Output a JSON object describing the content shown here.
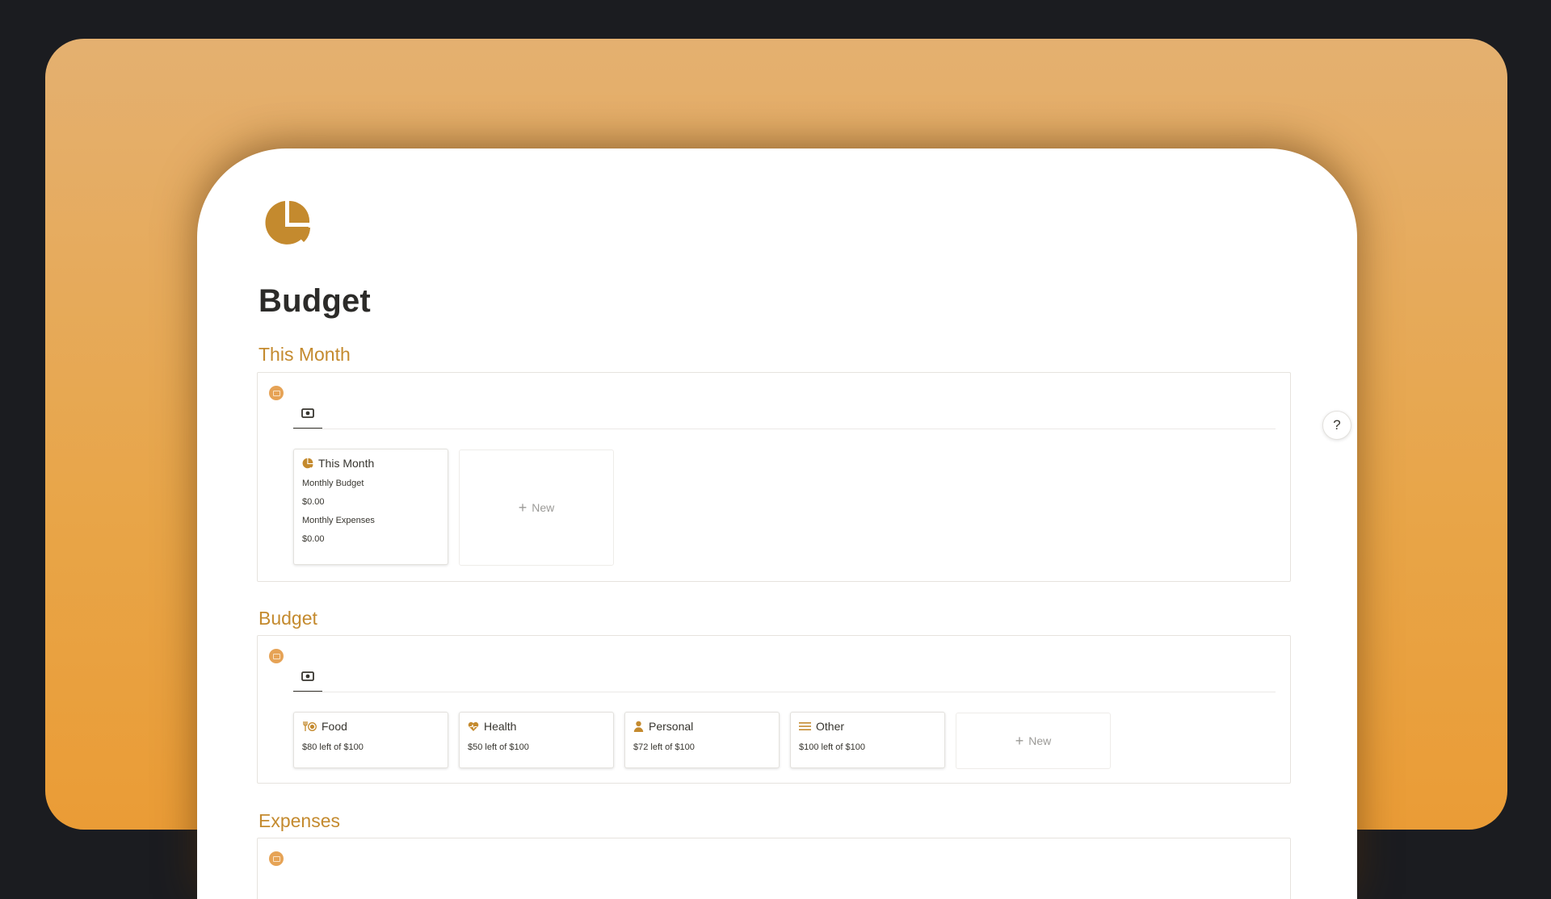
{
  "page": {
    "title": "Budget",
    "icon": "pie-chart-icon",
    "accent_color": "#c48a2e",
    "backdrop_color": "#e8a548"
  },
  "sections": {
    "this_month": {
      "heading": "This Month",
      "view_icon": "money-icon",
      "card": {
        "title": "This Month",
        "icon": "pie-chart-icon",
        "budget_label": "Monthly Budget",
        "budget_value": "$0.00",
        "expenses_label": "Monthly Expenses",
        "expenses_value": "$0.00"
      },
      "new_label": "New"
    },
    "budget": {
      "heading": "Budget",
      "view_icon": "money-icon",
      "cards": [
        {
          "title": "Food",
          "icon": "food-icon",
          "value": "$80 left of $100"
        },
        {
          "title": "Health",
          "icon": "heart-icon",
          "value": "$50 left of $100"
        },
        {
          "title": "Personal",
          "icon": "person-icon",
          "value": "$72 left of $100"
        },
        {
          "title": "Other",
          "icon": "menu-icon",
          "value": "$100 left of $100"
        }
      ],
      "new_label": "New"
    },
    "expenses": {
      "heading": "Expenses"
    }
  },
  "help": {
    "label": "?"
  }
}
